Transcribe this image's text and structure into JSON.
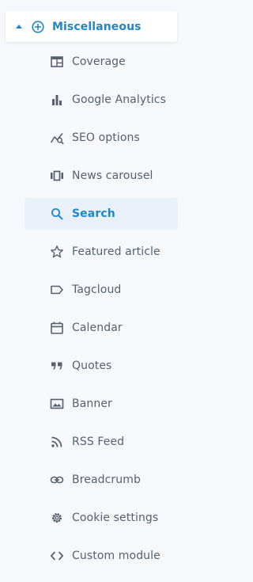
{
  "group": {
    "label": "Miscellaneous",
    "accent": "#1f86c8"
  },
  "menu": {
    "items": [
      {
        "label": "Coverage",
        "icon": "coverage-icon"
      },
      {
        "label": "Google Analytics",
        "icon": "bar-chart-icon"
      },
      {
        "label": "SEO options",
        "icon": "seo-trend-icon"
      },
      {
        "label": "News carousel",
        "icon": "carousel-icon"
      },
      {
        "label": "Search",
        "icon": "search-icon",
        "active": true
      },
      {
        "label": "Featured article",
        "icon": "star-icon"
      },
      {
        "label": "Tagcloud",
        "icon": "tag-icon"
      },
      {
        "label": "Calendar",
        "icon": "calendar-icon"
      },
      {
        "label": "Quotes",
        "icon": "quote-icon"
      },
      {
        "label": "Banner",
        "icon": "image-icon"
      },
      {
        "label": "RSS Feed",
        "icon": "rss-icon"
      },
      {
        "label": "Breadcrumb",
        "icon": "link-icon"
      },
      {
        "label": "Cookie settings",
        "icon": "gear-icon"
      },
      {
        "label": "Custom module",
        "icon": "code-icon"
      }
    ]
  },
  "colors": {
    "background": "#f6f8fc",
    "text": "#59606b",
    "active_bg": "#e9f0f8"
  }
}
